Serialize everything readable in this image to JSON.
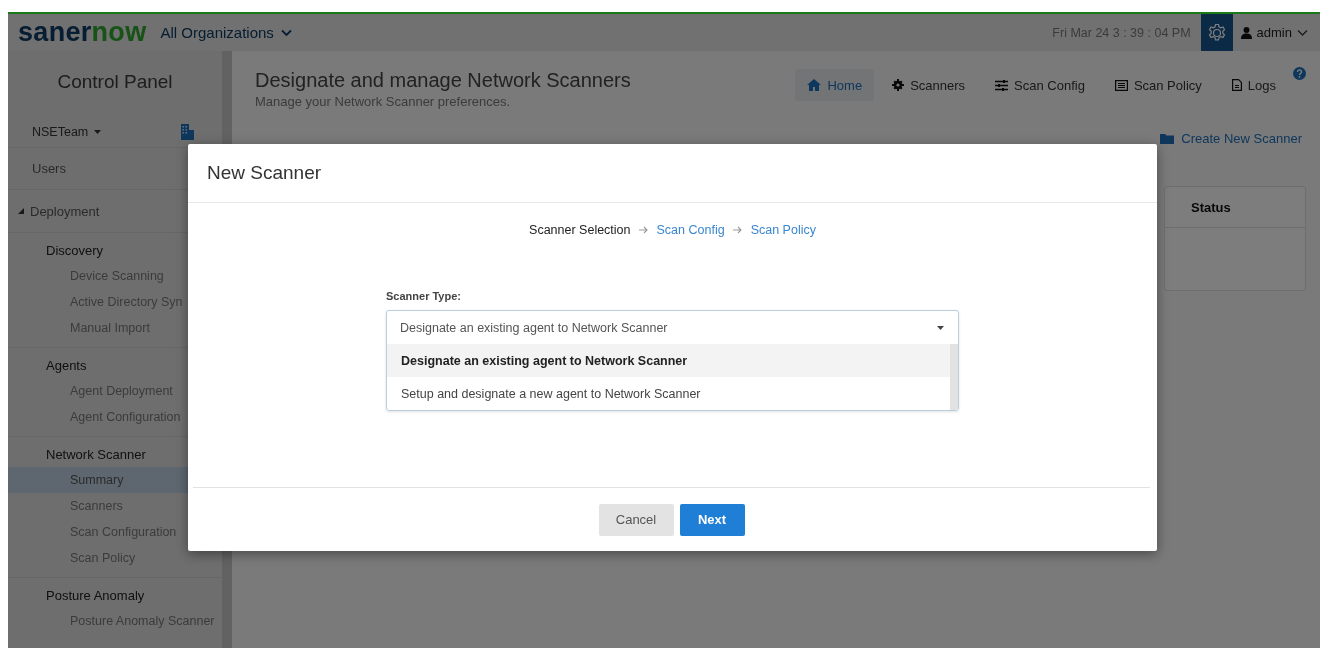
{
  "header": {
    "logo_first": "saner",
    "logo_second": "now",
    "organization": "All Organizations",
    "datetime": "Fri Mar 24  3 : 39 : 04 PM",
    "user": "admin"
  },
  "sidebar": {
    "title": "Control Panel",
    "team": "NSETeam",
    "items": [
      {
        "label": "Users",
        "kind": "link"
      },
      {
        "label": "Deployment",
        "kind": "section",
        "expanded": true
      }
    ],
    "groups": [
      {
        "title": "Discovery",
        "items": [
          {
            "label": "Device Scanning",
            "selected": false
          },
          {
            "label": "Active Directory Syn",
            "selected": false
          },
          {
            "label": "Manual Import",
            "selected": false
          }
        ]
      },
      {
        "title": "Agents",
        "items": [
          {
            "label": "Agent Deployment",
            "selected": false
          },
          {
            "label": "Agent Configuration",
            "selected": false
          }
        ]
      },
      {
        "title": "Network Scanner",
        "items": [
          {
            "label": "Summary",
            "selected": true
          },
          {
            "label": "Scanners",
            "selected": false
          },
          {
            "label": "Scan Configuration",
            "selected": false
          },
          {
            "label": "Scan Policy",
            "selected": false
          }
        ]
      },
      {
        "title": "Posture Anomaly",
        "items": [
          {
            "label": "Posture Anomaly Scanner",
            "selected": false
          }
        ]
      }
    ]
  },
  "page": {
    "title": "Designate and manage Network Scanners",
    "subtitle": "Manage your Network Scanner preferences.",
    "nav": [
      {
        "label": "Home",
        "kind": "home",
        "selected": true
      },
      {
        "label": "Scanners",
        "kind": "scanners",
        "selected": false
      },
      {
        "label": "Scan Config",
        "kind": "config",
        "selected": false
      },
      {
        "label": "Scan Policy",
        "kind": "policy",
        "selected": false
      },
      {
        "label": "Logs",
        "kind": "logs",
        "selected": false
      }
    ],
    "create_button": "Create New Scanner",
    "table_columns": [
      "Status"
    ]
  },
  "modal": {
    "title": "New Scanner",
    "steps": [
      {
        "label": "Scanner Selection",
        "current": true
      },
      {
        "label": "Scan Config",
        "current": false
      },
      {
        "label": "Scan Policy",
        "current": false
      }
    ],
    "field_label": "Scanner Type:",
    "value": "Designate an existing agent to Network Scanner",
    "expanded": true,
    "options": [
      {
        "label": "Designate an existing agent to Network Scanner",
        "selected": true
      },
      {
        "label": "Setup and designate a new agent to Network Scanner",
        "selected": false
      }
    ],
    "buttons": [
      {
        "label": "Cancel",
        "kind": "secondary"
      },
      {
        "label": "Next",
        "kind": "primary"
      }
    ]
  }
}
